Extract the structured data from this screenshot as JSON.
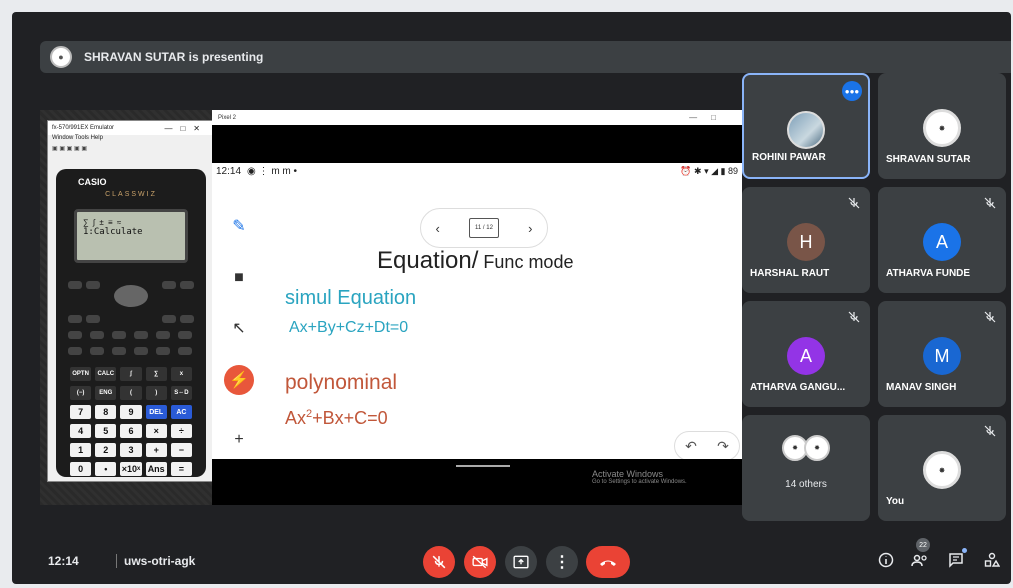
{
  "banner": {
    "presenting_text": "SHRAVAN SUTAR is presenting"
  },
  "presentation": {
    "calculator": {
      "window_title": "fx-570/991EX Emulator",
      "menu": "Window  Tools  Help",
      "brand": "CASIO",
      "model": "CLASSWIZ",
      "lcd_icons": "∑ ∫ ± ≡ ≈",
      "lcd_text": "1:Calculate",
      "keys": [
        "OPTN",
        "CALC",
        "∫",
        "∑",
        "x",
        "(−)",
        "ENG",
        "(",
        ")",
        "S⇔D",
        "7",
        "8",
        "9",
        "DEL",
        "AC",
        "4",
        "5",
        "6",
        "×",
        "÷",
        "1",
        "2",
        "3",
        "+",
        "−",
        "0",
        "•",
        "×10ˣ",
        "Ans",
        "="
      ]
    },
    "browser": {
      "window_title": "Pixel 2",
      "status_time": "12:14",
      "status_icons": "⏰ ✱ ▾ ◢ ▮ 89",
      "page_indicator": "11 / 12",
      "title_main": "Equation/",
      "title_sub": " Func mode",
      "simul_heading": "simul Equation",
      "simul_formula": "Ax+By+Cz+Dt=0",
      "poly_heading": "polynominal",
      "poly_formula_pre": "Ax",
      "poly_formula_exp": "2",
      "poly_formula_post": "+Bx+C=0",
      "activate_title": "Activate Windows",
      "activate_sub": "Go to Settings to activate Windows."
    }
  },
  "participants": [
    {
      "name": "ROHINI PAWAR",
      "initial": "",
      "color": "",
      "speaking": true
    },
    {
      "name": "SHRAVAN SUTAR",
      "initial": "",
      "color": "",
      "speaking": false
    },
    {
      "name": "HARSHAL RAUT",
      "initial": "H",
      "color": "#795548",
      "muted": true
    },
    {
      "name": "ATHARVA FUNDE",
      "initial": "A",
      "color": "#1a73e8",
      "muted": true
    },
    {
      "name": "ATHARVA GANGU...",
      "initial": "A",
      "color": "#9334e6",
      "muted": true
    },
    {
      "name": "MANAV SINGH",
      "initial": "M",
      "color": "#1967d2",
      "muted": true
    }
  ],
  "others": {
    "label": "14 others"
  },
  "self": {
    "label": "You"
  },
  "bottom": {
    "time": "12:14",
    "meeting_code": "uws-otri-agk",
    "participants_count": "22"
  }
}
